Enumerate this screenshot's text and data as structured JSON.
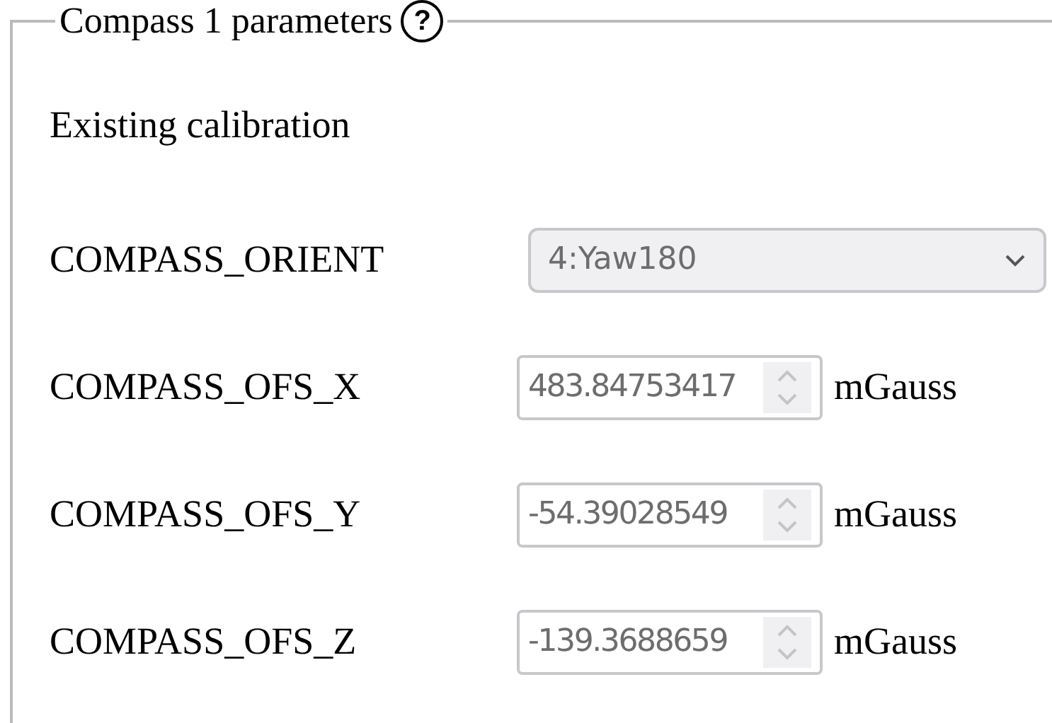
{
  "panel": {
    "title": "Compass 1 parameters",
    "help": "?"
  },
  "section_label": "Existing calibration",
  "params": [
    {
      "kind": "select",
      "label": "COMPASS_ORIENT",
      "value": "4:Yaw180",
      "disabled": true
    },
    {
      "kind": "number",
      "label": "COMPASS_OFS_X",
      "value": "483.84753417",
      "unit": "mGauss",
      "disabled": true
    },
    {
      "kind": "number",
      "label": "COMPASS_OFS_Y",
      "value": "-54.39028549",
      "unit": "mGauss",
      "disabled": true
    },
    {
      "kind": "number",
      "label": "COMPASS_OFS_Z",
      "value": "-139.3688659",
      "unit": "mGauss",
      "disabled": true
    }
  ]
}
